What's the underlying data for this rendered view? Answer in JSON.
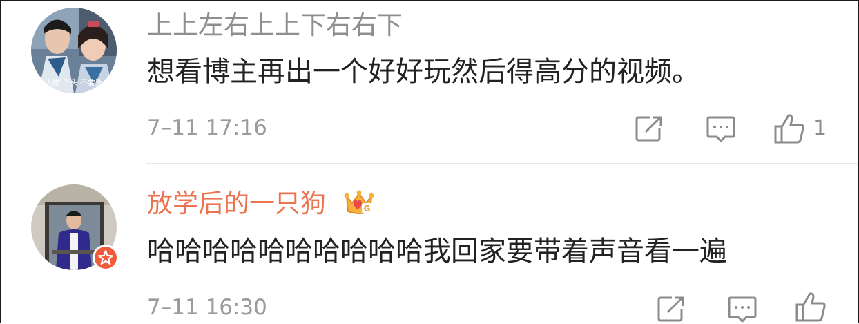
{
  "comments": [
    {
      "username": "上上左右上上下右右下",
      "text": "想看博主再出一个好好玩然后得高分的视频。",
      "time": "7–11 17:16",
      "like_count": "1",
      "avatar_caption": "人物 丫头 不要哭"
    },
    {
      "username": "放学后的一只狗",
      "text": "哈哈哈哈哈哈哈哈哈哈我回家要带着声音看一遍",
      "time": "7–11 16:30",
      "like_count": "",
      "badge_letter": "G"
    }
  ],
  "colors": {
    "username_default": "#8f8f8f",
    "username_vip": "#eb7350",
    "text": "#222222",
    "meta": "#9b9b9b",
    "icon": "#8b8b8b",
    "badge": "#f15a3a"
  },
  "icons": [
    "share-icon",
    "reply-icon",
    "like-icon",
    "crown-badge-icon",
    "verified-star-icon"
  ]
}
